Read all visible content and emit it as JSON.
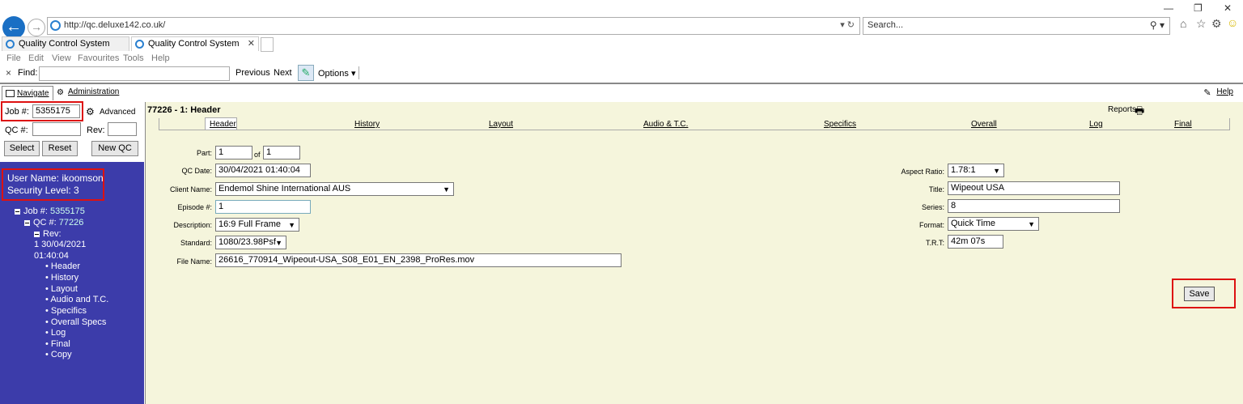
{
  "browser": {
    "url": "http://qc.deluxe142.co.uk/",
    "search_placeholder": "Search...",
    "tabs": [
      {
        "label": "Quality Control System"
      },
      {
        "label": "Quality Control System"
      }
    ],
    "menu": [
      "File",
      "Edit",
      "View",
      "Favourites",
      "Tools",
      "Help"
    ],
    "find": {
      "close": "×",
      "label": "Find:",
      "value": "",
      "previous": "Previous",
      "next": "Next",
      "options": "Options"
    }
  },
  "app": {
    "nav_tabs": {
      "navigate": "Navigate",
      "administration": "Administration",
      "help": "Help"
    },
    "left": {
      "job_label": "Job #:",
      "job_value": "5355175",
      "advanced": "Advanced",
      "qc_label": "QC #:",
      "qc_value": "",
      "rev_label": "Rev:",
      "rev_value": "",
      "select": "Select",
      "reset": "Reset",
      "new_qc": "New QC",
      "user_name": "User Name: ikoomson",
      "security_level": "Security Level: 3",
      "tree": {
        "job_label": "Job #:",
        "job_value": "5355175",
        "qc_label": "QC #:",
        "qc_value": "77226",
        "rev_label": "Rev:",
        "rev_value_1": "1  30/04/2021",
        "rev_value_2": "01:40:04",
        "items": [
          "Header",
          "History",
          "Layout",
          "Audio and T.C.",
          "Specifics",
          "Overall Specs",
          "Log",
          "Final",
          "Copy"
        ]
      }
    },
    "main": {
      "title": "77226 - 1: Header",
      "reports": "Reports",
      "subtabs": [
        "Header",
        "History",
        "Layout",
        "Audio & T.C.",
        "Specifics",
        "Overall",
        "Log",
        "Final"
      ],
      "fields": {
        "part_label": "Part:",
        "part_value": "1",
        "of_label": "of",
        "of_value": "1",
        "qc_date_label": "QC Date:",
        "qc_date_value": "30/04/2021 01:40:04",
        "client_label": "Client Name:",
        "client_value": "Endemol Shine International AUS",
        "episode_label": "Episode #:",
        "episode_value": "1",
        "description_label": "Description:",
        "description_value": "16:9 Full Frame",
        "standard_label": "Standard:",
        "standard_value": "1080/23.98Psf",
        "filename_label": "File Name:",
        "filename_value": "26616_770914_Wipeout-USA_S08_E01_EN_2398_ProRes.mov",
        "aspect_label": "Aspect Ratio:",
        "aspect_value": "1.78:1",
        "title_label": "Title:",
        "title_value": "Wipeout USA",
        "series_label": "Series:",
        "series_value": "8",
        "format_label": "Format:",
        "format_value": "Quick Time",
        "trt_label": "T.R.T:",
        "trt_value": "42m 07s"
      },
      "save": "Save"
    }
  }
}
